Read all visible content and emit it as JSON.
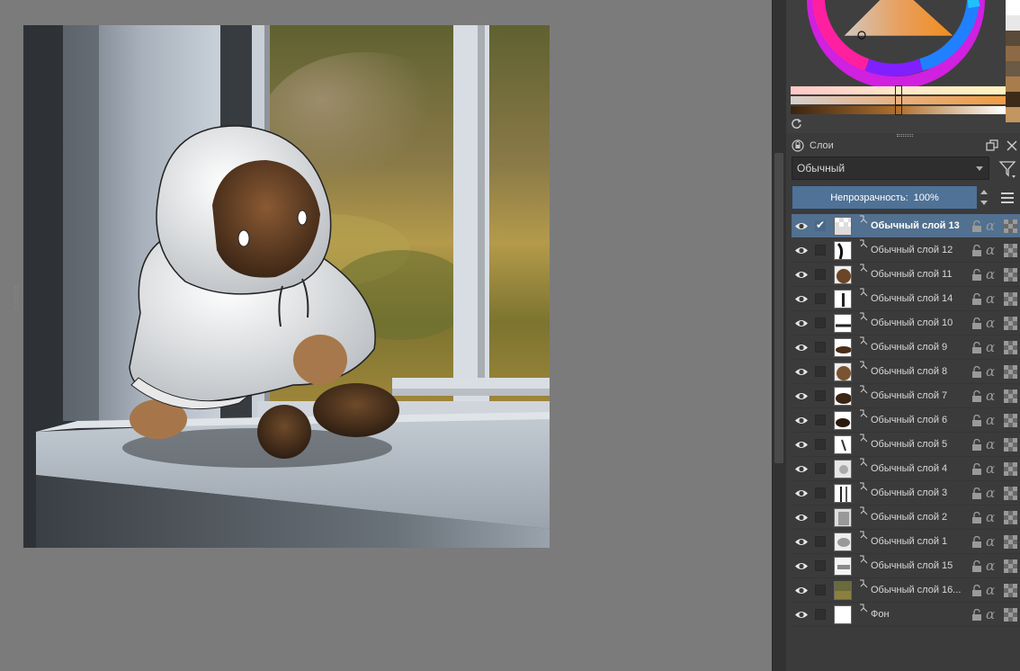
{
  "layers_panel": {
    "title": "Слои",
    "blend_mode": "Обычный",
    "opacity_label": "Непрозрачность:",
    "opacity_value": "100%",
    "layers": [
      {
        "name": "Обычный слой 13",
        "active": true,
        "checked": true
      },
      {
        "name": "Обычный слой 12",
        "active": false,
        "checked": false
      },
      {
        "name": "Обычный слой 11",
        "active": false,
        "checked": false
      },
      {
        "name": "Обычный слой 14",
        "active": false,
        "checked": false
      },
      {
        "name": "Обычный слой 10",
        "active": false,
        "checked": false
      },
      {
        "name": "Обычный слой 9",
        "active": false,
        "checked": false
      },
      {
        "name": "Обычный слой 8",
        "active": false,
        "checked": false
      },
      {
        "name": "Обычный слой 7",
        "active": false,
        "checked": false
      },
      {
        "name": "Обычный слой 6",
        "active": false,
        "checked": false
      },
      {
        "name": "Обычный слой 5",
        "active": false,
        "checked": false
      },
      {
        "name": "Обычный слой 4",
        "active": false,
        "checked": false
      },
      {
        "name": "Обычный слой 3",
        "active": false,
        "checked": false
      },
      {
        "name": "Обычный слой 2",
        "active": false,
        "checked": false
      },
      {
        "name": "Обычный слой 1",
        "active": false,
        "checked": false
      },
      {
        "name": "Обычный слой 15",
        "active": false,
        "checked": false
      },
      {
        "name": "Обычный слой 16...",
        "active": false,
        "checked": false
      },
      {
        "name": "Фон",
        "active": false,
        "checked": false
      }
    ]
  },
  "colors": {
    "accent": "#52708f",
    "panel_bg": "#3b3b3b",
    "canvas_bg": "#7b7b7b",
    "swatches": [
      "#ffffff",
      "#e8e8e8",
      "#b0b0b0",
      "#6b5a45",
      "#8c6a45",
      "#a97c4c",
      "#c29561",
      "#5a3e24"
    ]
  },
  "icons": {
    "visibility": "eye-icon",
    "lock": "lock-icon",
    "alpha": "alpha-lock-icon",
    "inherit_alpha": "inherit-alpha-icon",
    "filter": "filter-icon",
    "menu": "hamburger-menu-icon",
    "float": "float-docker-icon",
    "close": "close-icon"
  }
}
